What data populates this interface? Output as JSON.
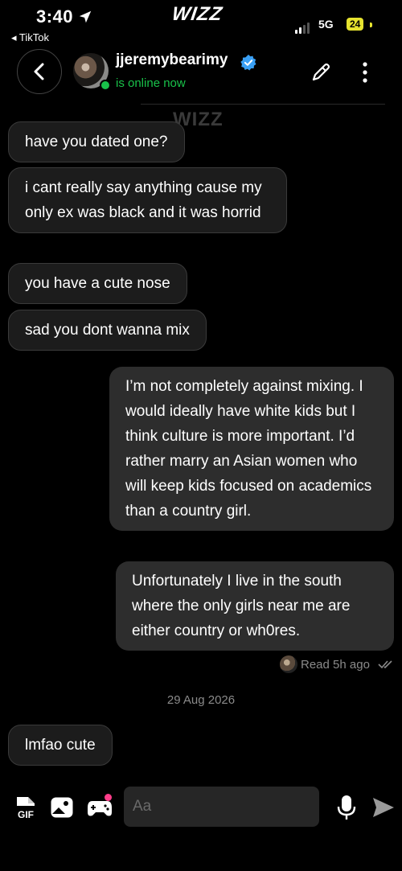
{
  "status": {
    "time": "3:40",
    "back_app": "◂ TikTok",
    "network": "5G",
    "battery": "24"
  },
  "brand": {
    "logo": "WIZZ",
    "watermark": "WIZZ"
  },
  "header": {
    "username": "jjeremybearimy",
    "online_status": "is online now"
  },
  "messages": [
    {
      "side": "in",
      "text": "have you dated one?"
    },
    {
      "side": "in",
      "text": "i cant really say anything cause my only ex was black and it was horrid"
    },
    {
      "side": "in",
      "text": "you have a cute nose"
    },
    {
      "side": "in",
      "text": "sad you dont wanna mix"
    },
    {
      "side": "out",
      "text": "I’m not completely against mixing. I would ideally have white kids but I think culture is more important. I’d rather marry an Asian women who will keep kids focused on academics than a country girl."
    },
    {
      "side": "out",
      "text": "Unfortunately I live in the south where the only girls near me are either country or wh0res."
    },
    {
      "side": "in",
      "text": "lmfao cute"
    }
  ],
  "read_receipt": "Read 5h ago",
  "date_separator": "29 Aug 2026",
  "composer": {
    "placeholder": "Aa",
    "gif_label": "GIF"
  }
}
